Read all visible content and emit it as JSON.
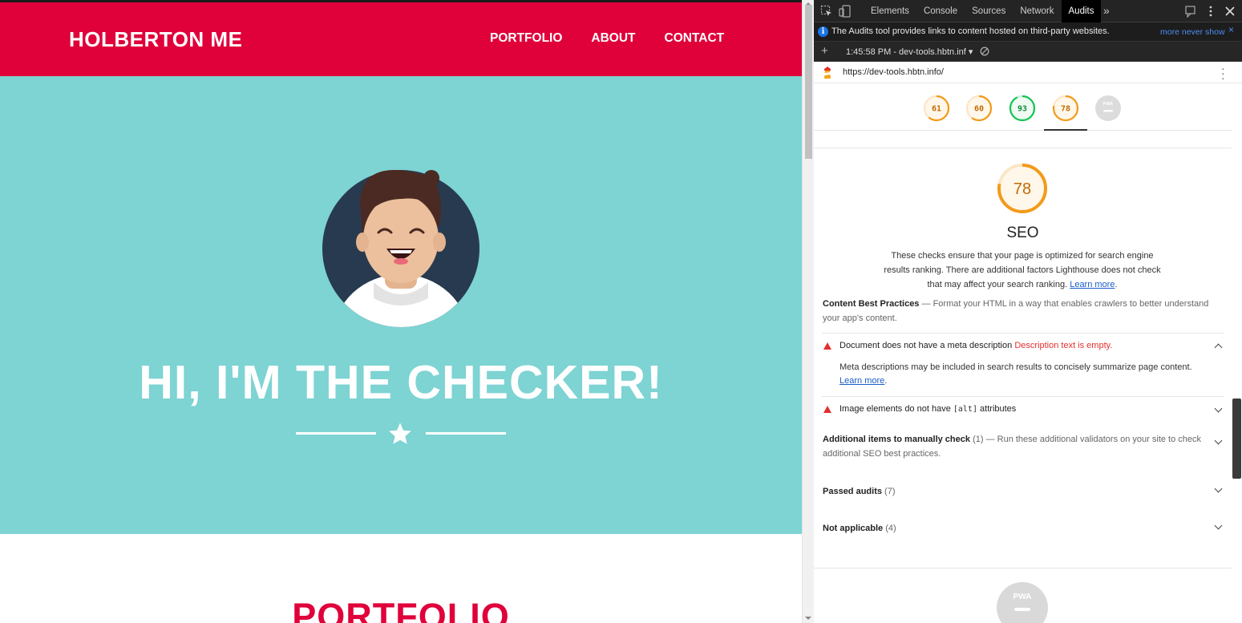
{
  "site": {
    "brand": "HOLBERTON ME",
    "nav": [
      "PORTFOLIO",
      "ABOUT",
      "CONTACT"
    ],
    "hero_title": "HI, I'M THE CHECKER!",
    "section_heading": "PORTFOLIO",
    "colors": {
      "brand_red": "#e0003a",
      "hero_teal": "#7ed3d3"
    }
  },
  "devtools": {
    "tabs": [
      "Elements",
      "Console",
      "Sources",
      "Network",
      "Audits"
    ],
    "active_tab": "Audits",
    "more_tabs": "»",
    "info_bar": {
      "text": "The Audits tool provides links to content hosted on third-party websites.",
      "link_more": "more",
      "link_never": "never show",
      "close": "×"
    },
    "report_select": "1:45:58 PM - dev-tools.hbtn.inf ▾",
    "url": "https://dev-tools.hbtn.info/",
    "gauges": [
      {
        "label": "61",
        "value": 61,
        "color": "#f29b1a"
      },
      {
        "label": "60",
        "value": 60,
        "color": "#f29b1a"
      },
      {
        "label": "93",
        "value": 93,
        "color": "#17c455"
      },
      {
        "label": "78",
        "value": 78,
        "color": "#f29b1a"
      },
      {
        "label": "PWA",
        "value": 0,
        "color": "#bdbdbd"
      }
    ],
    "seo": {
      "score": "78",
      "score_value": 78,
      "title": "SEO",
      "description": "These checks ensure that your page is optimized for search engine results ranking. There are additional factors Lighthouse does not check that may affect your search ranking.",
      "learn_more": "Learn more",
      "content_best_practices": {
        "title": "Content Best Practices",
        "desc": "Format your HTML in a way that enables crawlers to better understand your app’s content."
      },
      "audits": [
        {
          "title": "Document does not have a meta description",
          "error": "Description text is empty.",
          "detail": "Meta descriptions may be included in search results to concisely summarize page content.",
          "detail_link": "Learn more"
        },
        {
          "title_pre": "Image elements do not have",
          "code": "[alt]",
          "title_post": "attributes"
        }
      ],
      "manual": {
        "title": "Additional items to manually check",
        "count": "(1)",
        "desc": "Run these additional validators on your site to check additional SEO best practices."
      },
      "passed": {
        "title": "Passed audits",
        "count": "(7)"
      },
      "not_applicable": {
        "title": "Not applicable",
        "count": "(4)"
      }
    },
    "pwa_label": "PWA"
  }
}
